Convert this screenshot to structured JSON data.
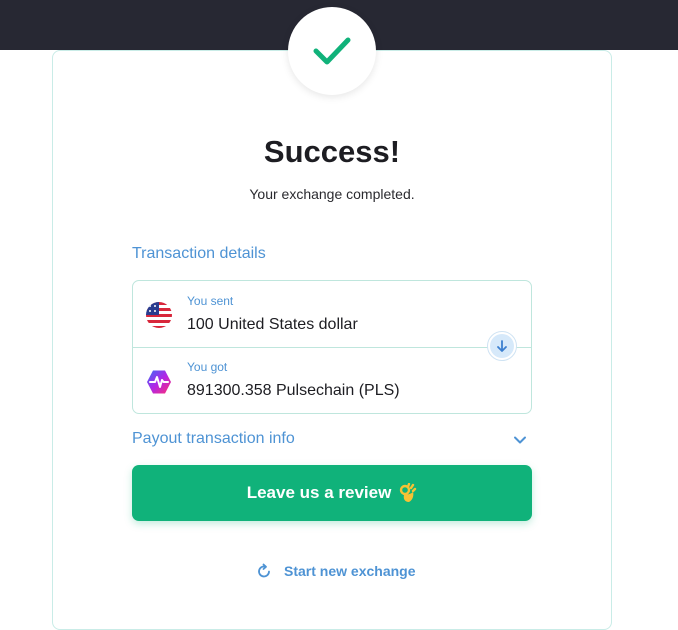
{
  "header": {
    "title": "Success!",
    "subtitle": "Your exchange completed."
  },
  "transaction": {
    "section_label": "Transaction details",
    "sent": {
      "label": "You sent",
      "amount": "100 United States dollar",
      "icon": "usd-flag-icon"
    },
    "got": {
      "label": "You got",
      "amount": "891300.358 Pulsechain (PLS)",
      "icon": "pulsechain-icon"
    }
  },
  "payout": {
    "label": "Payout transaction info"
  },
  "actions": {
    "review_label": "Leave us a review",
    "new_exchange_label": "Start new exchange"
  },
  "colors": {
    "accent_green": "#10b27a",
    "link_blue": "#4e93d4",
    "top_bar": "#272833",
    "check_green": "#10b27a"
  }
}
